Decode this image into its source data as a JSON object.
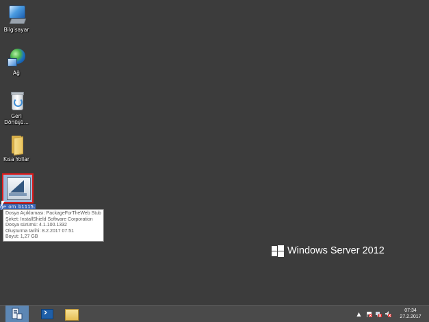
{
  "desktop": {
    "icons": [
      {
        "label": "Bilgisayar"
      },
      {
        "label": "Ağ"
      },
      {
        "label": "Geri Dönüşü..."
      },
      {
        "label": "Kısa Yollar"
      },
      {
        "label": "ge_om_b1115..."
      }
    ]
  },
  "tooltip": {
    "lines": [
      "Dosya Açıklaması: PackageForTheWeb Stub",
      "Şirket: InstallShield Software Corporation",
      "Dosya sürümü: 4.1.100.1332",
      "Oluşturma tarihi: 8.2.2017 07:51",
      "Boyut: 1,27 GB"
    ]
  },
  "branding": {
    "text": "Windows Server 2012"
  },
  "taskbar": {
    "clock_time": "07:34",
    "clock_date": "27.2.2017",
    "tray_overflow": "▲"
  },
  "colors": {
    "desktop_bg": "#3c3c3c",
    "selection_border": "#e01a1a",
    "taskbar_active": "#5d87b4"
  }
}
